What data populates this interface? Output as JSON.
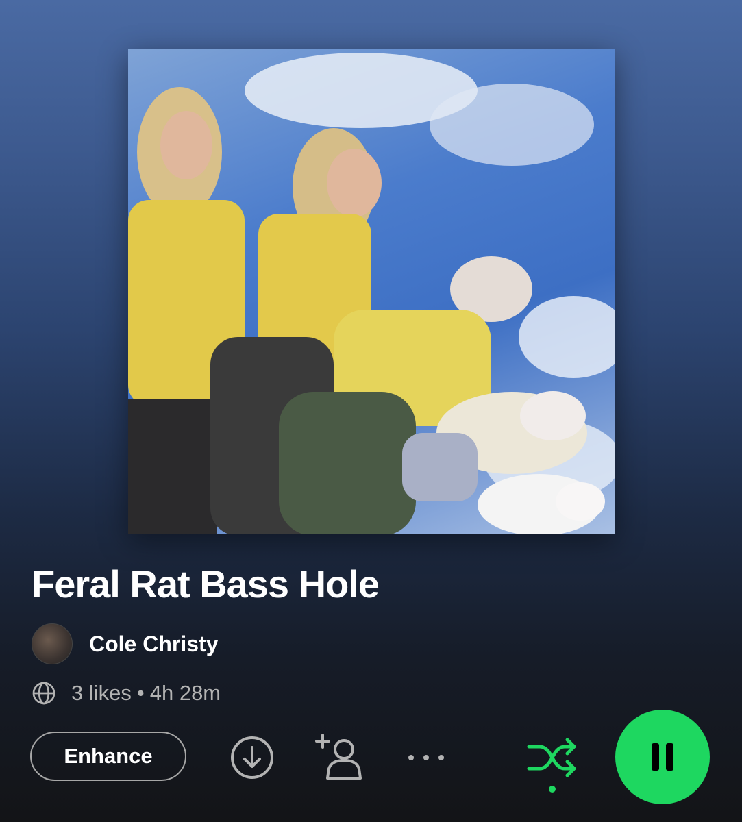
{
  "playlist": {
    "title": "Feral Rat Bass Hole",
    "owner": "Cole Christy",
    "likes": "3 likes",
    "separator": "•",
    "duration": "4h 28m"
  },
  "actions": {
    "enhance_label": "Enhance"
  },
  "icons": {
    "globe": "globe-icon",
    "download": "download-icon",
    "add_user": "add-user-icon",
    "more": "more-options-icon",
    "shuffle": "shuffle-icon",
    "pause": "pause-icon"
  },
  "colors": {
    "accent": "#1ed760",
    "muted_text": "#b3b3b3"
  }
}
